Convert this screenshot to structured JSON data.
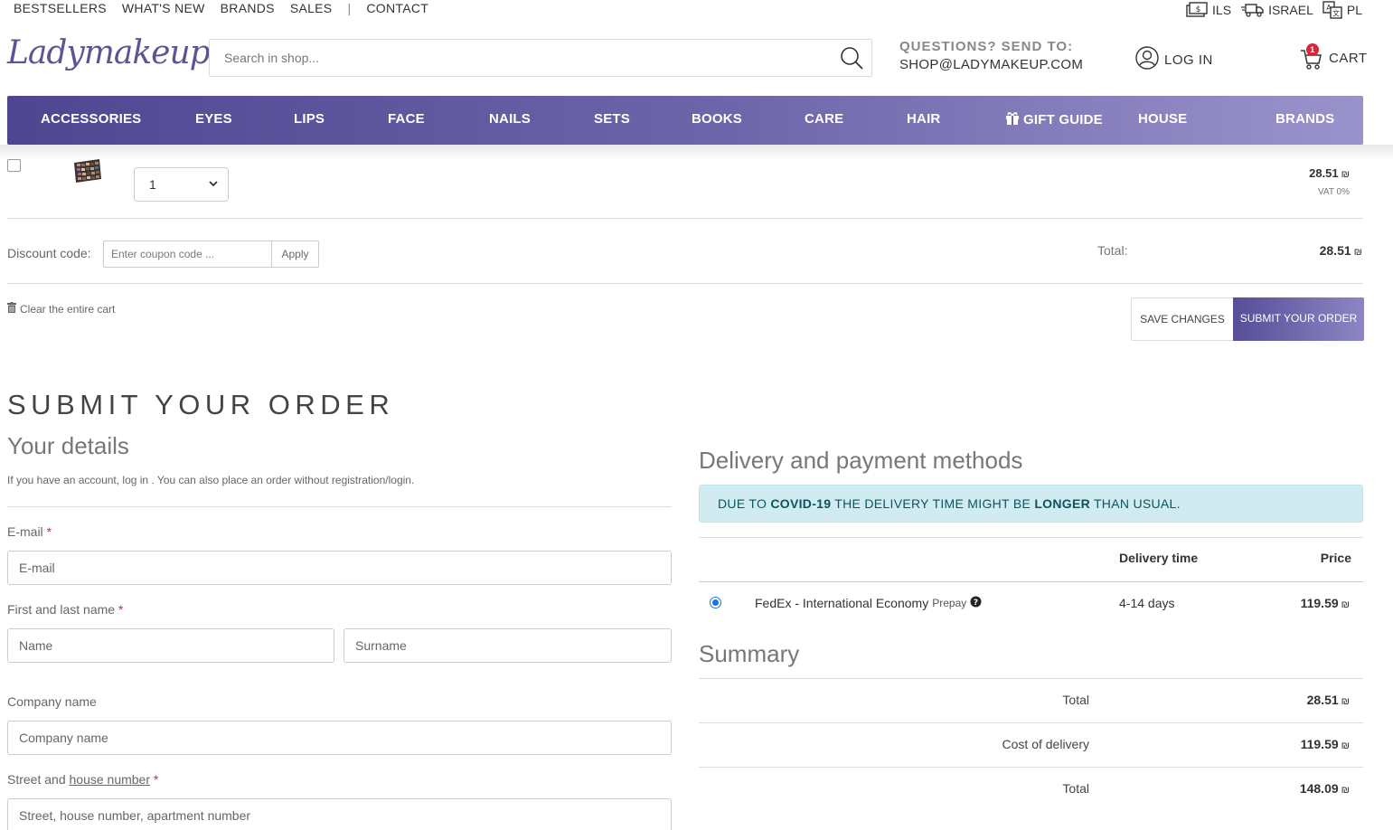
{
  "topbar": {
    "links": [
      "BESTSELLERS",
      "WHAT'S NEW",
      "BRANDS",
      "SALES",
      "CONTACT"
    ],
    "separator": "|",
    "currency": "ILS",
    "country": "ISRAEL",
    "language": "PL"
  },
  "header": {
    "logo": "Ladymakeup",
    "search_placeholder": "Search in shop...",
    "questions_label": "QUESTIONS? SEND TO:",
    "questions_email": "SHOP@LADYMAKEUP.COM",
    "login_label": "LOG IN",
    "cart_label": "CART",
    "cart_count": "1"
  },
  "nav": {
    "items": [
      "ACCESSORIES",
      "EYES",
      "LIPS",
      "FACE",
      "NAILS",
      "SETS",
      "BOOKS",
      "CARE",
      "HAIR",
      "GIFT GUIDE",
      "HOUSE",
      "BRANDS"
    ]
  },
  "cart": {
    "quantity": "1",
    "row_price": "28.51",
    "row_vat": "VAT 0%",
    "currency_symbol": "₪",
    "discount_label": "Discount code:",
    "discount_placeholder": "Enter coupon code ...",
    "apply_label": "Apply",
    "total_label": "Total:",
    "total_value": "28.51",
    "clear_label": "Clear the entire cart",
    "save_label": "SAVE CHANGES",
    "submit_label": "SUBMIT YOUR ORDER"
  },
  "order": {
    "title": "SUBMIT YOUR ORDER",
    "details_title": "Your details",
    "intro_prefix": "If you have an account, ",
    "intro_link": "log in",
    "intro_suffix": " . You can also place an order without registration/login.",
    "email_label": "E-mail",
    "email_placeholder": "E-mail",
    "name_label": "First and last name",
    "name_placeholder": "Name",
    "surname_placeholder": "Surname",
    "company_label": "Company name",
    "company_placeholder": "Company name",
    "street_label_a": "Street and ",
    "street_label_b": "house number",
    "street_placeholder": "Street, house number, apartment number",
    "required_mark": "*"
  },
  "delivery": {
    "title": "Delivery and payment methods",
    "covid_1": "DUE TO ",
    "covid_2": "COVID-19",
    "covid_3": " THE DELIVERY TIME MIGHT BE ",
    "covid_4": "LONGER",
    "covid_5": " THAN USUAL.",
    "col_time": "Delivery time",
    "col_price": "Price",
    "carrier": "FedEx - International Economy",
    "carrier_note": "Prepay",
    "days": "4-14 days",
    "price": "119.59"
  },
  "summary": {
    "title": "Summary",
    "rows": [
      {
        "label": "Total",
        "value": "28.51"
      },
      {
        "label": "Cost of delivery",
        "value": "119.59"
      },
      {
        "label": "Total",
        "value": "148.09"
      }
    ]
  }
}
